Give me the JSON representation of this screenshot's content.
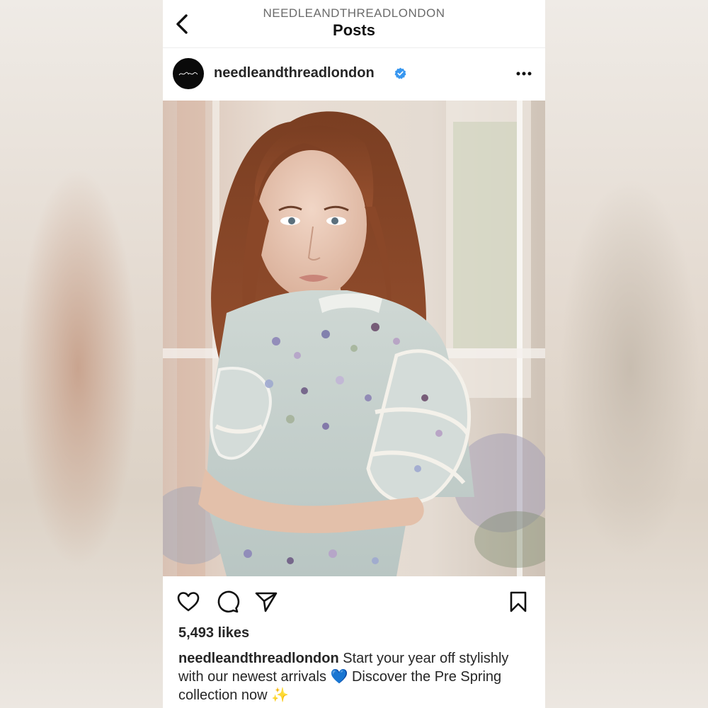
{
  "header": {
    "account_caps": "NEEDLEANDTHREADLONDON",
    "title": "Posts",
    "back_icon": "chevron-left-icon"
  },
  "post": {
    "username": "needleandthreadlondon",
    "verified": true,
    "avatar_text": "needle & thread",
    "more_icon": "more-horizontal-icon",
    "likes": "5,493 likes",
    "caption_user": "needleandthreadlondon",
    "caption_text": "Start your year off stylishly with our newest arrivals 💙 Discover the Pre Spring collection now ✨"
  },
  "actions": {
    "like_icon": "heart-icon",
    "comment_icon": "comment-icon",
    "share_icon": "share-icon",
    "save_icon": "bookmark-icon"
  },
  "colors": {
    "verified": "#3897f0",
    "text": "#262626",
    "muted": "#6b6b6b"
  }
}
